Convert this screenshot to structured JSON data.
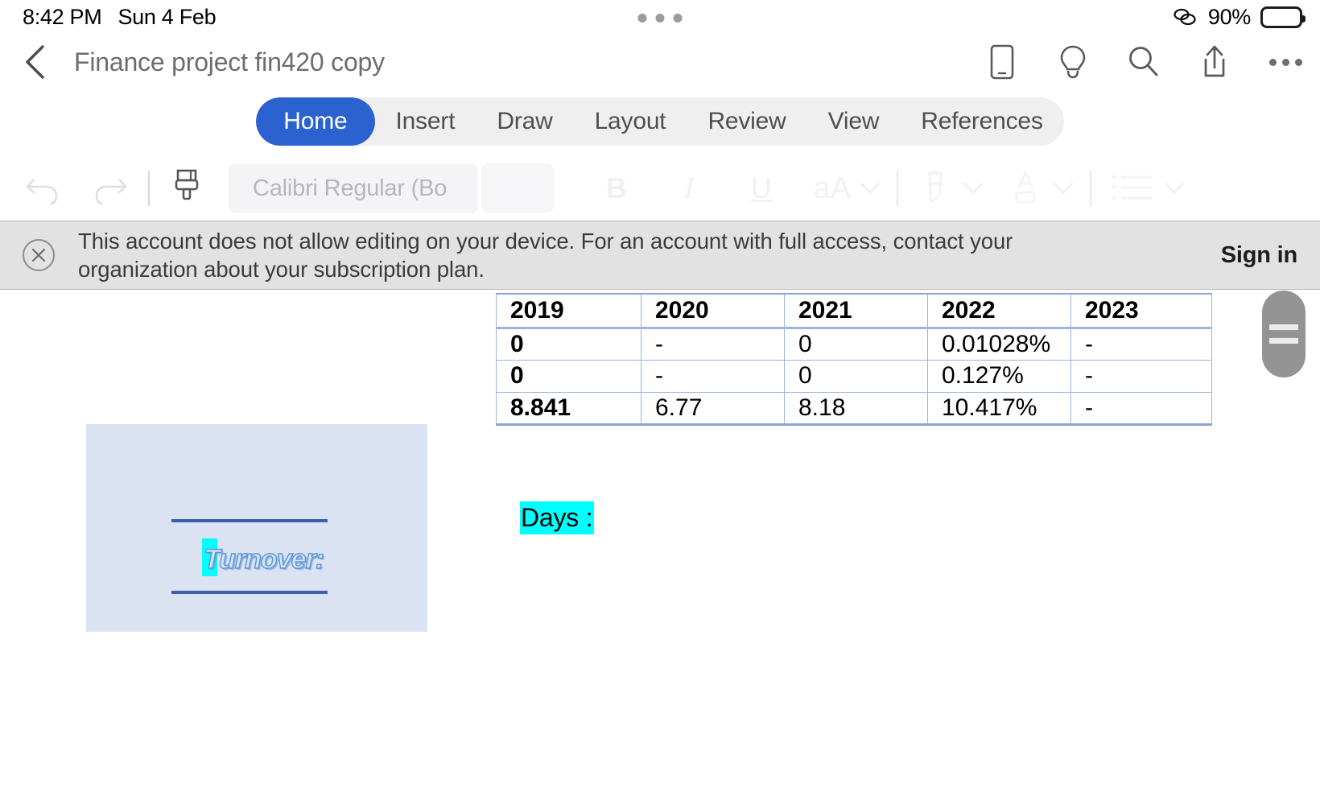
{
  "status_bar": {
    "time": "8:42 PM",
    "date": "Sun 4 Feb",
    "battery_percent": "90%",
    "link_icon": "link-icon",
    "battery_icon": "battery-icon",
    "center_dots_icon": "dynamic-island-dots-icon"
  },
  "title_bar": {
    "back_icon": "back-chevron-icon",
    "document_title": "Finance project fin420 copy",
    "icons": [
      {
        "name": "mobile-view-icon"
      },
      {
        "name": "lightbulb-icon"
      },
      {
        "name": "search-icon"
      },
      {
        "name": "share-icon"
      },
      {
        "name": "more-options-icon"
      }
    ]
  },
  "ribbon": {
    "tabs": [
      {
        "label": "Home",
        "active": true
      },
      {
        "label": "Insert",
        "active": false
      },
      {
        "label": "Draw",
        "active": false
      },
      {
        "label": "Layout",
        "active": false
      },
      {
        "label": "Review",
        "active": false
      },
      {
        "label": "View",
        "active": false
      },
      {
        "label": "References",
        "active": false
      }
    ],
    "active_tab_color": "#2b62d0",
    "tabs_background": "#efeff0"
  },
  "format_toolbar": {
    "undo_icon": "undo-icon",
    "redo_icon": "redo-icon",
    "format_painter_icon": "format-painter-icon",
    "font_name": "Calibri Regular (Bo",
    "font_name_placeholder": "Calibri Regular (Bo",
    "font_size": "",
    "bold_label": "B",
    "italic_label": "I",
    "underline_label": "U",
    "font_case_label": "aA",
    "highlight_icon": "highlighter-pen-icon",
    "font_color_label": "A",
    "bullet_list_icon": "bulleted-list-icon",
    "disabled": true
  },
  "banner": {
    "close_icon": "close-circle-icon",
    "message": "This account does not allow editing on your device. For an account with full access, contact your organization about your subscription plan.",
    "sign_in_label": "Sign in",
    "background": "#e2e2e2"
  },
  "document": {
    "table": {
      "headers": [
        "2019",
        "2020",
        "2021",
        "2022",
        "2023"
      ],
      "rows": [
        [
          "0",
          "-",
          "0",
          "0.01028%",
          "-"
        ],
        [
          "0",
          "-",
          "0",
          "0.127%",
          "-"
        ],
        [
          "8.841",
          "6.77",
          "8.18",
          "10.417%",
          "-"
        ]
      ],
      "border_color": "#9db3e0"
    },
    "days_label": "Days :",
    "days_highlight_color": "#00ffff",
    "image_box": {
      "background": "#dbe2f2",
      "wordart_text": "Turnover:",
      "wordart_highlight_color": "#00ffff",
      "rule_color": "#3b5fac"
    }
  },
  "scroll_handle": {
    "icon": "scroll-drag-handle-icon"
  }
}
